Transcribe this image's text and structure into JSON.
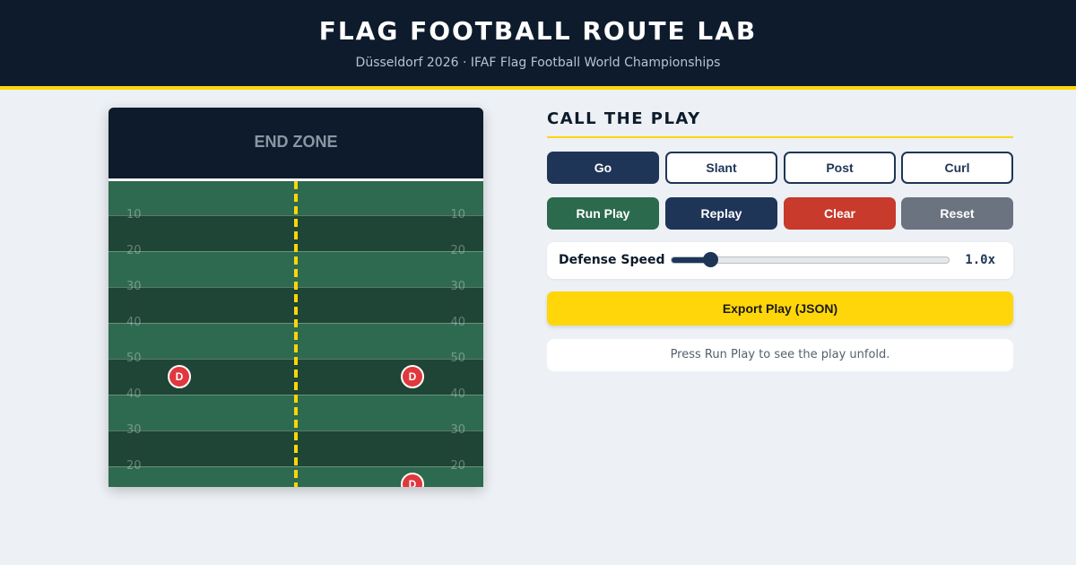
{
  "header": {
    "title": "FLAG FOOTBALL ROUTE LAB",
    "subtitle": "Düsseldorf 2026 · IFAF Flag Football World Championships"
  },
  "colors": {
    "header_bg": "#0d1b2c",
    "accent": "#ffd60a",
    "field_light": "#2e6a4f",
    "field_dark": "#1e4536",
    "defender": "#e0383e",
    "navy": "#1e3557"
  },
  "field": {
    "endzone_label": "END ZONE",
    "yard_numbers": [
      "10",
      "20",
      "30",
      "40",
      "50",
      "40",
      "30",
      "20"
    ],
    "defender_label": "D",
    "defender_count_visible": 3
  },
  "panel": {
    "title": "CALL THE PLAY",
    "routes": [
      {
        "label": "Go",
        "active": true
      },
      {
        "label": "Slant",
        "active": false
      },
      {
        "label": "Post",
        "active": false
      },
      {
        "label": "Curl",
        "active": false
      }
    ],
    "actions": {
      "run": "Run Play",
      "replay": "Replay",
      "clear": "Clear",
      "reset": "Reset"
    },
    "speed": {
      "label": "Defense Speed",
      "value_text": "1.0x",
      "fraction": 0.14
    },
    "export_label": "Export Play (JSON)",
    "status": "Press Run Play to see the play unfold."
  }
}
